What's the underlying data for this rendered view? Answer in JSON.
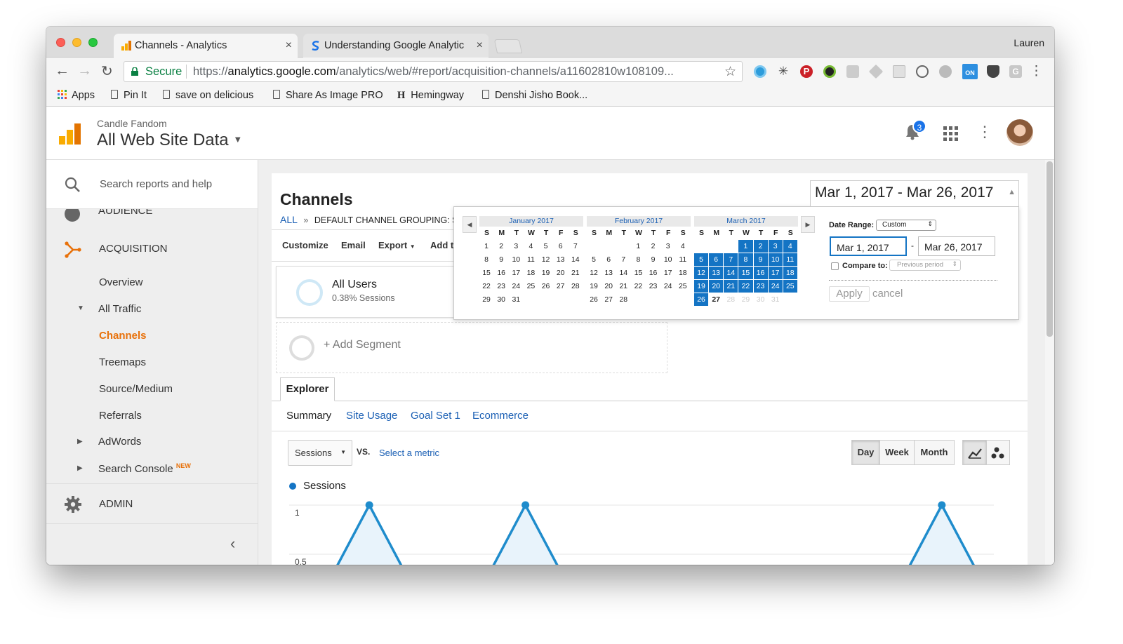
{
  "browser": {
    "tabs": [
      {
        "title": "Channels - Analytics"
      },
      {
        "title": "Understanding Google Analytic"
      }
    ],
    "user": "Lauren",
    "secure_label": "Secure",
    "url_prefix": "https://",
    "url_host": "analytics.google.com",
    "url_path": "/analytics/web/#report/acquisition-channels/a11602810w108109...",
    "bookmarks": [
      {
        "label": "Apps"
      },
      {
        "label": "Pin It"
      },
      {
        "label": "save on delicious"
      },
      {
        "label": "Share As Image PRO"
      },
      {
        "label": "Hemingway"
      },
      {
        "label": "Denshi Jisho Book..."
      }
    ]
  },
  "header": {
    "account": "Candle Fandom",
    "property": "All Web Site Data",
    "notification_count": "3"
  },
  "sidebar": {
    "search_placeholder": "Search reports and help",
    "audience_label": "AUDIENCE",
    "acquisition_label": "ACQUISITION",
    "items": {
      "overview": "Overview",
      "all_traffic": "All Traffic",
      "channels": "Channels",
      "treemaps": "Treemaps",
      "source_medium": "Source/Medium",
      "referrals": "Referrals",
      "adwords": "AdWords",
      "search_console": "Search Console",
      "new_badge": "NEW"
    },
    "admin_label": "ADMIN"
  },
  "report": {
    "title": "Channels",
    "breadcrumb_all": "ALL",
    "breadcrumb_sep": "»",
    "breadcrumb_grouping": "DEFAULT CHANNEL GROUPING: Sc",
    "toolbar": {
      "customize": "Customize",
      "email": "Email",
      "export": "Export",
      "add": "Add t"
    },
    "segment": {
      "name": "All Users",
      "detail": "0.38% Sessions",
      "add": "+ Add Segment"
    },
    "explorer_tab": "Explorer",
    "subtabs": [
      "Summary",
      "Site Usage",
      "Goal Set 1",
      "Ecommerce"
    ],
    "metric_select": "Sessions",
    "vs_label": "VS.",
    "select_metric": "Select a metric",
    "granularity": [
      "Day",
      "Week",
      "Month"
    ],
    "legend_label": "Sessions"
  },
  "date_picker": {
    "display_range": "Mar 1, 2017 - Mar 26, 2017",
    "range_label": "Date Range:",
    "range_option": "Custom",
    "start_date": "Mar 1, 2017",
    "end_date": "Mar 26, 2017",
    "date_sep": "-",
    "compare_label": "Compare to:",
    "compare_option": "Previous period",
    "apply": "Apply",
    "cancel": "cancel",
    "weekday_headers": [
      "S",
      "M",
      "T",
      "W",
      "T",
      "F",
      "S"
    ],
    "months": [
      {
        "title": "January 2017",
        "start_weekday": 0,
        "days": 31
      },
      {
        "title": "February 2017",
        "start_weekday": 3,
        "days": 28
      },
      {
        "title": "March 2017",
        "start_weekday": 3,
        "days": 31,
        "selected_through": 26,
        "today": 27
      }
    ]
  },
  "chart_data": {
    "type": "line",
    "series": [
      {
        "name": "Sessions",
        "values": [
          0,
          1,
          0,
          0,
          1,
          0,
          0,
          0,
          0,
          0,
          0,
          0,
          1,
          0
        ]
      }
    ],
    "y_ticks": [
      "1",
      "0.5"
    ],
    "ylim": [
      0,
      1
    ],
    "color": "#1f8ccc"
  },
  "colors": {
    "accent_orange": "#e8710a",
    "brand_blue": "#1474c4",
    "selected_day": "#1474c4",
    "secure_green": "#0b8043",
    "link_blue": "#1a5fb4"
  }
}
